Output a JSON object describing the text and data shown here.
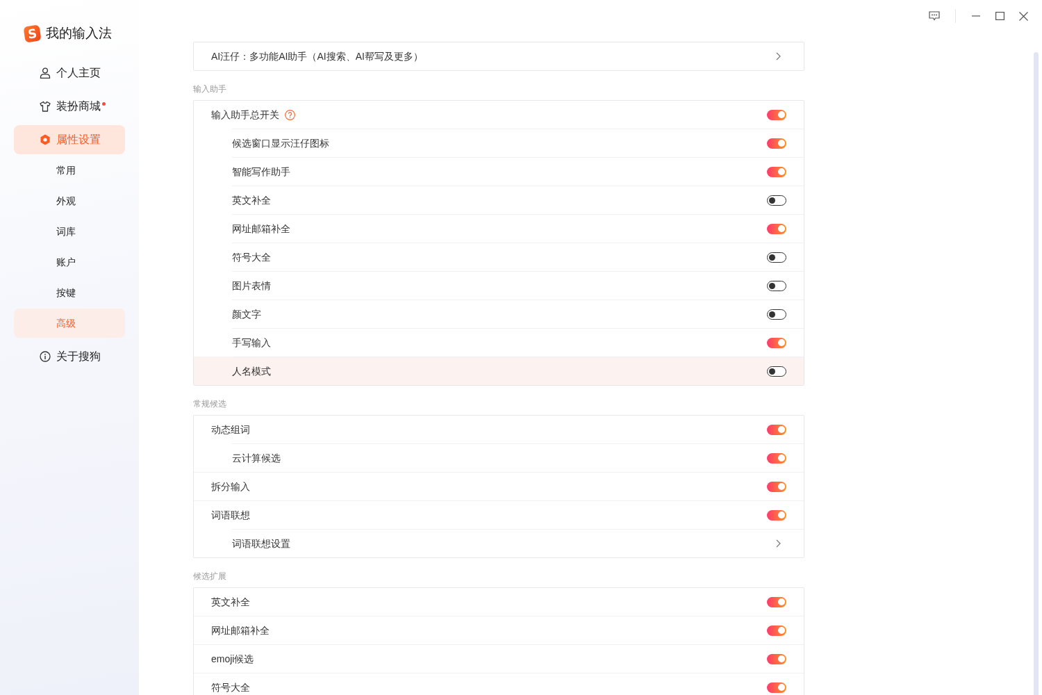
{
  "sidebar": {
    "logo_letter": "S",
    "app_title": "我的输入法",
    "items": [
      {
        "label": "个人主页",
        "selected": false,
        "dot": false
      },
      {
        "label": "装扮商城",
        "selected": false,
        "dot": true
      },
      {
        "label": "属性设置",
        "selected": true,
        "dot": false,
        "children": [
          {
            "label": "常用",
            "selected": false
          },
          {
            "label": "外观",
            "selected": false
          },
          {
            "label": "词库",
            "selected": false
          },
          {
            "label": "账户",
            "selected": false
          },
          {
            "label": "按键",
            "selected": false
          },
          {
            "label": "高级",
            "selected": true
          }
        ]
      },
      {
        "label": "关于搜狗",
        "selected": false,
        "dot": false
      }
    ]
  },
  "sections": [
    {
      "rows": [
        {
          "label": "AI汪仔：多功能AI助手（AI搜索、AI帮写及更多）",
          "kind": "link",
          "hovered": false
        }
      ]
    },
    {
      "heading": "输入助手",
      "rows": [
        {
          "label": "输入助手总开关",
          "kind": "toggle",
          "on": true,
          "help": true,
          "hovered": false,
          "children": [
            {
              "label": "候选窗口显示汪仔图标",
              "kind": "toggle",
              "on": true,
              "hovered": false
            },
            {
              "label": "智能写作助手",
              "kind": "toggle",
              "on": true,
              "hovered": false
            },
            {
              "label": "英文补全",
              "kind": "toggle",
              "on": false,
              "hovered": false
            },
            {
              "label": "网址邮箱补全",
              "kind": "toggle",
              "on": true,
              "hovered": false
            },
            {
              "label": "符号大全",
              "kind": "toggle",
              "on": false,
              "hovered": false
            },
            {
              "label": "图片表情",
              "kind": "toggle",
              "on": false,
              "hovered": false
            },
            {
              "label": "颜文字",
              "kind": "toggle",
              "on": false,
              "hovered": false
            },
            {
              "label": "手写输入",
              "kind": "toggle",
              "on": true,
              "hovered": false
            },
            {
              "label": "人名模式",
              "kind": "toggle",
              "on": false,
              "hovered": true
            }
          ]
        }
      ]
    },
    {
      "heading": "常规候选",
      "rows": [
        {
          "label": "动态组词",
          "kind": "toggle",
          "on": true,
          "hovered": false,
          "children": [
            {
              "label": "云计算候选",
              "kind": "toggle",
              "on": true,
              "hovered": false
            }
          ]
        },
        {
          "label": "拆分输入",
          "kind": "toggle",
          "on": true,
          "hovered": false
        },
        {
          "label": "词语联想",
          "kind": "toggle",
          "on": true,
          "hovered": false,
          "children": [
            {
              "label": "词语联想设置",
              "kind": "link",
              "hovered": false
            }
          ]
        }
      ]
    },
    {
      "heading": "候选扩展",
      "rows": [
        {
          "label": "英文补全",
          "kind": "toggle",
          "on": true,
          "hovered": false
        },
        {
          "label": "网址邮箱补全",
          "kind": "toggle",
          "on": true,
          "hovered": false
        },
        {
          "label": "emoji候选",
          "kind": "toggle",
          "on": true,
          "hovered": false
        },
        {
          "label": "符号大全",
          "kind": "toggle",
          "on": true,
          "hovered": false
        }
      ]
    }
  ]
}
